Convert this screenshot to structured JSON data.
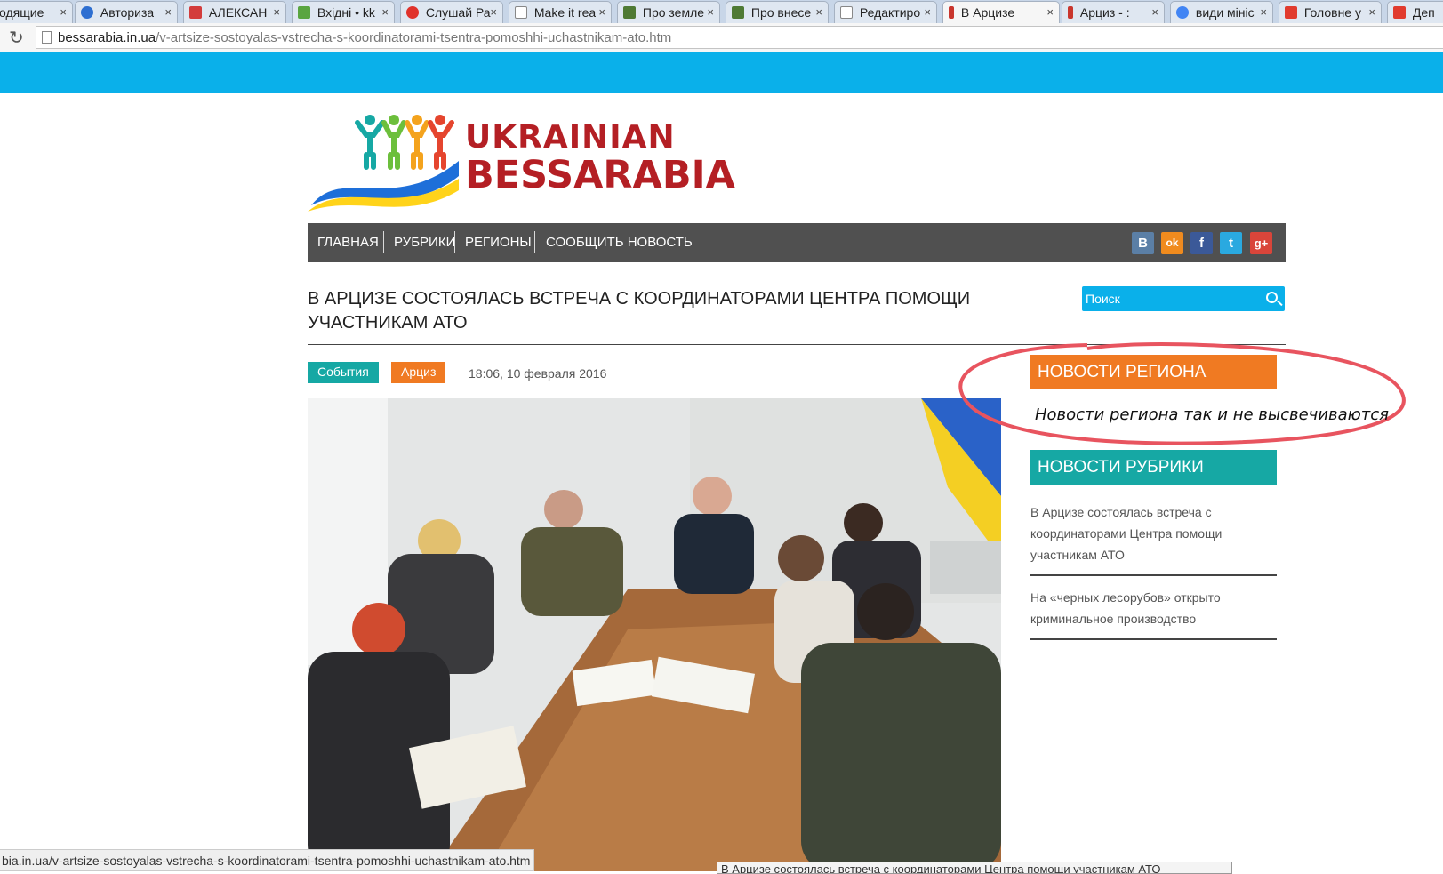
{
  "browser": {
    "tabs": [
      {
        "label": "одящие",
        "icon_color": "#888888"
      },
      {
        "label": "Авториза",
        "icon_color": "#2e6fd1"
      },
      {
        "label": "АЛЕКСАН",
        "icon_color": "#d33c3c"
      },
      {
        "label": "Вхідні • kk",
        "icon_color": "#5aa540"
      },
      {
        "label": "Слушай Ра",
        "icon_color": "#e0322b"
      },
      {
        "label": "Make it rea",
        "icon_color": "#ffffff"
      },
      {
        "label": "Про земле",
        "icon_color": "#4f7a34"
      },
      {
        "label": "Про внесе",
        "icon_color": "#4f7a34"
      },
      {
        "label": "Редактиро",
        "icon_color": "#ffffff"
      },
      {
        "label": "В Арцизе",
        "icon_color": "#c9362d"
      },
      {
        "label": "Арциз - :",
        "icon_color": "#c9362d"
      },
      {
        "label": "види мініс",
        "icon_color": "#4285f4"
      },
      {
        "label": "Головне у",
        "icon_color": "#e13b2e"
      },
      {
        "label": "Деп",
        "icon_color": "#e13b2e"
      }
    ],
    "close_glyph": "×",
    "url_host": "bessarabia.in.ua",
    "url_path": "/v-artsize-sostoyalas-vstrecha-s-koordinatorami-tsentra-pomoshhi-uchastnikam-ato.htm",
    "status_url": "bia.in.ua/v-artsize-sostoyalas-vstrecha-s-koordinatorami-tsentra-pomoshhi-uchastnikam-ato.htm",
    "tooltip": "В Арцизе состоялась встреча с координаторами Центра помощи участникам АТО"
  },
  "logo": {
    "line1": "UKRAINIAN",
    "line2": "BESSARABIA"
  },
  "nav": {
    "items": [
      "ГЛАВНАЯ",
      "РУБРИКИ",
      "РЕГИОНЫ",
      "СООБЩИТЬ НОВОСТЬ"
    ]
  },
  "social": [
    {
      "name": "vk",
      "glyph": "B",
      "color": "#5b7fa6"
    },
    {
      "name": "odnoklassniki",
      "glyph": "ok",
      "color": "#f08b1e"
    },
    {
      "name": "facebook",
      "glyph": "f",
      "color": "#3b5998"
    },
    {
      "name": "twitter",
      "glyph": "t",
      "color": "#2aa9e0"
    },
    {
      "name": "google-plus",
      "glyph": "g+",
      "color": "#d9453a"
    }
  ],
  "search": {
    "placeholder": "Поиск"
  },
  "article": {
    "title": "В АРЦИЗЕ СОСТОЯЛАСЬ ВСТРЕЧА С КООРДИНАТОРАМИ ЦЕНТРА ПОМОЩИ УЧАСТНИКАМ АТО",
    "category": "События",
    "region": "Арциз",
    "date": "18:06, 10 февраля 2016"
  },
  "sidebar": {
    "region_news_heading": "НОВОСТИ РЕГИОНА",
    "annotation": "Новости региона так и не высвечиваются",
    "rubric_news_heading": "НОВОСТИ РУБРИКИ",
    "links": [
      "В Арцизе состоялась встреча с координаторами Центра помощи участникам АТО",
      "На «черных лесорубов» открыто криминальное производство"
    ]
  },
  "colors": {
    "accent_blue": "#0ab0ea",
    "teal": "#16a8a4",
    "orange": "#f07a22",
    "brand_red": "#b41f24",
    "nav_gray": "#505050",
    "annotation_red": "#e8545f"
  }
}
